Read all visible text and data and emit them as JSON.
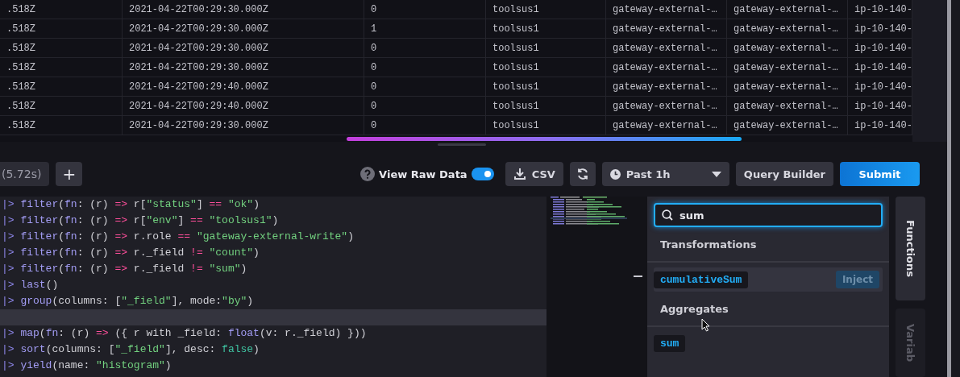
{
  "table": {
    "rows": [
      [
        ".518Z",
        "2021-04-22T00:29:30.000Z",
        "0",
        "toolsus1",
        "gateway-external-…",
        "gateway-external-…",
        "ip-10-140-"
      ],
      [
        ".518Z",
        "2021-04-22T00:29:30.000Z",
        "1",
        "toolsus1",
        "gateway-external-…",
        "gateway-external-…",
        "ip-10-140-"
      ],
      [
        ".518Z",
        "2021-04-22T00:29:30.000Z",
        "0",
        "toolsus1",
        "gateway-external-…",
        "gateway-external-…",
        "ip-10-140-"
      ],
      [
        ".518Z",
        "2021-04-22T00:29:30.000Z",
        "0",
        "toolsus1",
        "gateway-external-…",
        "gateway-external-…",
        "ip-10-140-"
      ],
      [
        ".518Z",
        "2021-04-22T00:29:40.000Z",
        "0",
        "toolsus1",
        "gateway-external-…",
        "gateway-external-…",
        "ip-10-140-"
      ],
      [
        ".518Z",
        "2021-04-22T00:29:40.000Z",
        "0",
        "toolsus1",
        "gateway-external-…",
        "gateway-external-…",
        "ip-10-140-"
      ],
      [
        ".518Z",
        "2021-04-22T00:29:30.000Z",
        "0",
        "toolsus1",
        "gateway-external-…",
        "gateway-external-…",
        "ip-10-140-"
      ]
    ]
  },
  "toolbar": {
    "query_tab": "(5.72s)",
    "add_button": "+",
    "raw_data_label": "View Raw Data",
    "raw_data_on": true,
    "csv_button": "CSV",
    "time_range": "Past 1h",
    "query_builder_button": "Query Builder",
    "submit_button": "Submit"
  },
  "editor": {
    "lines": [
      {
        "active": false,
        "tokens": [
          {
            "kind": "pipe",
            "text": "|> "
          },
          {
            "kind": "func",
            "text": "filter"
          },
          {
            "kind": "punct",
            "text": "("
          },
          {
            "kind": "param",
            "text": "fn"
          },
          {
            "kind": "punct",
            "text": ": (r) "
          },
          {
            "kind": "op",
            "text": "=>"
          },
          {
            "kind": "punct",
            "text": " r["
          },
          {
            "kind": "string",
            "text": "\"status\""
          },
          {
            "kind": "punct",
            "text": "] "
          },
          {
            "kind": "op",
            "text": "== "
          },
          {
            "kind": "string",
            "text": "\"ok\""
          },
          {
            "kind": "punct",
            "text": ")"
          }
        ]
      },
      {
        "active": false,
        "tokens": [
          {
            "kind": "pipe",
            "text": "|> "
          },
          {
            "kind": "func",
            "text": "filter"
          },
          {
            "kind": "punct",
            "text": "("
          },
          {
            "kind": "param",
            "text": "fn"
          },
          {
            "kind": "punct",
            "text": ": (r) "
          },
          {
            "kind": "op",
            "text": "=>"
          },
          {
            "kind": "punct",
            "text": " r["
          },
          {
            "kind": "string",
            "text": "\"env\""
          },
          {
            "kind": "punct",
            "text": "] "
          },
          {
            "kind": "op",
            "text": "== "
          },
          {
            "kind": "string",
            "text": "\"toolsus1\""
          },
          {
            "kind": "punct",
            "text": ")"
          }
        ]
      },
      {
        "active": false,
        "tokens": [
          {
            "kind": "pipe",
            "text": "|> "
          },
          {
            "kind": "func",
            "text": "filter"
          },
          {
            "kind": "punct",
            "text": "("
          },
          {
            "kind": "param",
            "text": "fn"
          },
          {
            "kind": "punct",
            "text": ": (r) "
          },
          {
            "kind": "op",
            "text": "=>"
          },
          {
            "kind": "punct",
            "text": " r.role "
          },
          {
            "kind": "op",
            "text": "== "
          },
          {
            "kind": "string",
            "text": "\"gateway-external-write\""
          },
          {
            "kind": "punct",
            "text": ")"
          }
        ]
      },
      {
        "active": false,
        "tokens": [
          {
            "kind": "pipe",
            "text": "|> "
          },
          {
            "kind": "func",
            "text": "filter"
          },
          {
            "kind": "punct",
            "text": "("
          },
          {
            "kind": "param",
            "text": "fn"
          },
          {
            "kind": "punct",
            "text": ": (r) "
          },
          {
            "kind": "op",
            "text": "=>"
          },
          {
            "kind": "punct",
            "text": " r._field "
          },
          {
            "kind": "op",
            "text": "!= "
          },
          {
            "kind": "string",
            "text": "\"count\""
          },
          {
            "kind": "punct",
            "text": ")"
          }
        ]
      },
      {
        "active": false,
        "tokens": [
          {
            "kind": "pipe",
            "text": "|> "
          },
          {
            "kind": "func",
            "text": "filter"
          },
          {
            "kind": "punct",
            "text": "("
          },
          {
            "kind": "param",
            "text": "fn"
          },
          {
            "kind": "punct",
            "text": ": (r) "
          },
          {
            "kind": "op",
            "text": "=>"
          },
          {
            "kind": "punct",
            "text": " r._field "
          },
          {
            "kind": "op",
            "text": "!= "
          },
          {
            "kind": "string",
            "text": "\"sum\""
          },
          {
            "kind": "punct",
            "text": ")"
          }
        ]
      },
      {
        "active": false,
        "tokens": [
          {
            "kind": "pipe",
            "text": "|> "
          },
          {
            "kind": "func",
            "text": "last"
          },
          {
            "kind": "punct",
            "text": "()"
          }
        ]
      },
      {
        "active": false,
        "tokens": [
          {
            "kind": "pipe",
            "text": "|> "
          },
          {
            "kind": "func",
            "text": "group"
          },
          {
            "kind": "punct",
            "text": "(columns: ["
          },
          {
            "kind": "string",
            "text": "\"_field\""
          },
          {
            "kind": "punct",
            "text": "], mode:"
          },
          {
            "kind": "string",
            "text": "\"by\""
          },
          {
            "kind": "punct",
            "text": ")"
          }
        ]
      },
      {
        "active": true
      },
      {
        "active": false,
        "tokens": [
          {
            "kind": "pipe",
            "text": "|> "
          },
          {
            "kind": "func",
            "text": "map"
          },
          {
            "kind": "punct",
            "text": "("
          },
          {
            "kind": "param",
            "text": "fn"
          },
          {
            "kind": "punct",
            "text": ": (r) "
          },
          {
            "kind": "op",
            "text": "=>"
          },
          {
            "kind": "punct",
            "text": " ({ r with _field: "
          },
          {
            "kind": "func",
            "text": "float"
          },
          {
            "kind": "punct",
            "text": "(v: r._field) }))"
          }
        ]
      },
      {
        "active": false,
        "tokens": [
          {
            "kind": "pipe",
            "text": "|> "
          },
          {
            "kind": "func",
            "text": "sort"
          },
          {
            "kind": "punct",
            "text": "(columns: ["
          },
          {
            "kind": "string",
            "text": "\"_field\""
          },
          {
            "kind": "punct",
            "text": "], desc: "
          },
          {
            "kind": "bool",
            "text": "false"
          },
          {
            "kind": "punct",
            "text": ")"
          }
        ]
      },
      {
        "active": false,
        "tokens": [
          {
            "kind": "pipe",
            "text": "|> "
          },
          {
            "kind": "func",
            "text": "yield"
          },
          {
            "kind": "punct",
            "text": "(name: "
          },
          {
            "kind": "string",
            "text": "\"histogram\""
          },
          {
            "kind": "punct",
            "text": ")"
          }
        ]
      }
    ]
  },
  "functions_panel": {
    "search_value": "sum",
    "groups": [
      {
        "title": "Transformations",
        "items": [
          {
            "name": "cumulativeSum",
            "hovered": true,
            "action": "Inject"
          }
        ]
      },
      {
        "title": "Aggregates",
        "items": [
          {
            "name": "sum",
            "hovered": false
          }
        ]
      }
    ]
  },
  "side_tabs": [
    {
      "label": "Functions",
      "selected": true
    },
    {
      "label": "Variab",
      "selected": false
    }
  ]
}
